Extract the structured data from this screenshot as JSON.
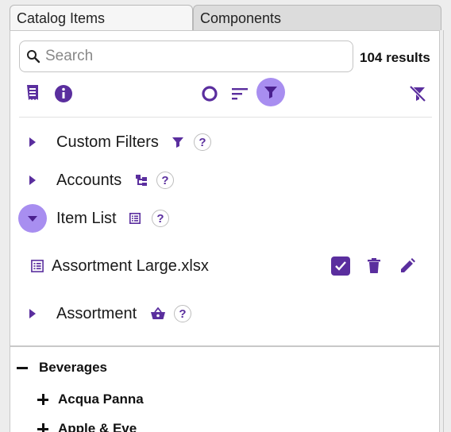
{
  "tabs": [
    "Catalog Items",
    "Components"
  ],
  "search": {
    "placeholder": "Search",
    "value": ""
  },
  "results_label": "104 results",
  "toolbar": {
    "left_icons": [
      "receipt-icon",
      "info-icon"
    ],
    "right_icons": [
      "circle-outline-icon",
      "sort-icon",
      "filter-icon"
    ],
    "far_right_icon": "filter-off-icon"
  },
  "filters": [
    {
      "label": "Custom Filters",
      "icon": "filter-icon",
      "expanded": false
    },
    {
      "label": "Accounts",
      "icon": "hierarchy-icon",
      "expanded": false
    },
    {
      "label": "Item List",
      "icon": "list-icon",
      "expanded": true
    },
    {
      "label": "Assortment",
      "icon": "basket-icon",
      "expanded": false
    }
  ],
  "item_list_file": {
    "name": "Assortment Large.xlsx",
    "checked": true
  },
  "help_symbol": "?",
  "tree": [
    {
      "label": "Beverages",
      "expanded": true
    },
    {
      "label": "Acqua Panna",
      "expanded": false
    },
    {
      "label": "Apple & Eve",
      "expanded": false
    }
  ],
  "colors": {
    "accent": "#5a2e9e",
    "accent_light": "#a88ef0"
  }
}
